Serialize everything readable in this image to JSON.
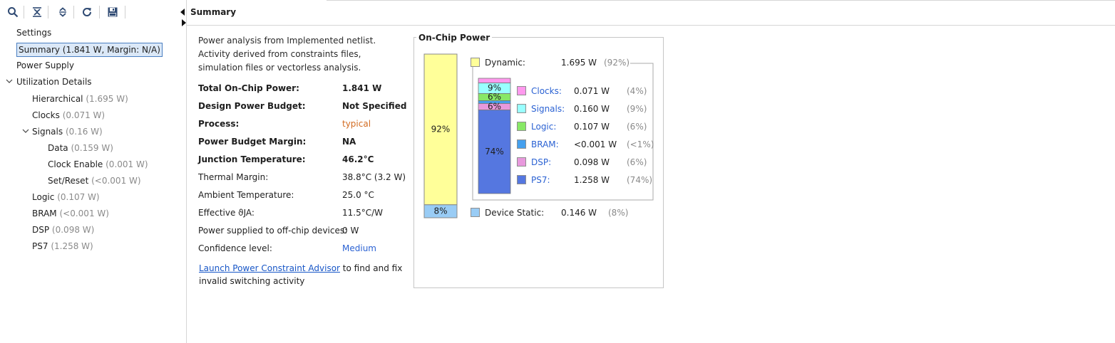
{
  "toolbar": {
    "icons": [
      "search-icon",
      "collapse-all-icon",
      "expand-all-icon",
      "refresh-icon",
      "save-icon"
    ]
  },
  "tree": {
    "settings": "Settings",
    "summary": "Summary (1.841 W, Margin: N/A)",
    "power_supply": "Power Supply",
    "utilization": "Utilization Details",
    "hierarchical": {
      "label": "Hierarchical",
      "value": "(1.695 W)"
    },
    "clocks": {
      "label": "Clocks",
      "value": "(0.071 W)"
    },
    "signals": {
      "label": "Signals",
      "value": "(0.16 W)"
    },
    "data": {
      "label": "Data",
      "value": "(0.159 W)"
    },
    "clock_enable": {
      "label": "Clock Enable",
      "value": "(0.001 W)"
    },
    "set_reset": {
      "label": "Set/Reset",
      "value": "(<0.001 W)"
    },
    "logic": {
      "label": "Logic",
      "value": "(0.107 W)"
    },
    "bram": {
      "label": "BRAM",
      "value": "(<0.001 W)"
    },
    "dsp": {
      "label": "DSP",
      "value": "(0.098 W)"
    },
    "ps7": {
      "label": "PS7",
      "value": "(1.258 W)"
    }
  },
  "tab": {
    "title": "Summary"
  },
  "summary": {
    "intro": "Power analysis from Implemented netlist. Activity derived from constraints files, simulation files or vectorless analysis.",
    "rows": [
      {
        "label": "Total On-Chip Power:",
        "value": "1.841 W"
      },
      {
        "label": "Design Power Budget:",
        "value": "Not Specified"
      },
      {
        "label": "Process:",
        "value": "typical"
      },
      {
        "label": "Power Budget Margin:",
        "value": "NA"
      },
      {
        "label": "Junction Temperature:",
        "value": "46.2°C"
      },
      {
        "label": "Thermal Margin:",
        "value": "38.8°C (3.2 W)"
      },
      {
        "label": "Ambient Temperature:",
        "value": "25.0 °C"
      },
      {
        "label": "Effective ϑJA:",
        "value": "11.5°C/W"
      },
      {
        "label": "Power supplied to off-chip devices:",
        "value": "0 W"
      },
      {
        "label": "Confidence level:",
        "value": "Medium"
      }
    ],
    "advisor_link": "Launch Power Constraint Advisor",
    "advisor_text": " to find and fix invalid switching activity"
  },
  "colors": {
    "dynamic": "#ffff99",
    "static": "#99ccf5",
    "clocks": "#ff99ee",
    "signals": "#99ffff",
    "logic": "#88e866",
    "bram": "#45a0ee",
    "dsp": "#e899dd",
    "ps7": "#5577e0"
  },
  "chart_data": {
    "type": "bar",
    "title": "On-Chip Power",
    "total": {
      "categories": [
        "Dynamic",
        "Device Static"
      ],
      "values": [
        1.695,
        0.146
      ],
      "percent_labels": [
        "92%",
        "8%"
      ]
    },
    "dynamic_breakdown": {
      "categories": [
        "Clocks",
        "Signals",
        "Logic",
        "BRAM",
        "DSP",
        "PS7"
      ],
      "values": [
        0.071,
        0.16,
        0.107,
        0.0005,
        0.098,
        1.258
      ],
      "percent_labels": [
        "",
        "9%",
        "6%",
        "",
        "6%",
        "74%"
      ]
    },
    "legend": {
      "dynamic": {
        "label": "Dynamic:",
        "value": "1.695 W",
        "pct": "(92%)"
      },
      "static": {
        "label": "Device Static:",
        "value": "0.146 W",
        "pct": "(8%)"
      },
      "items": [
        {
          "label": "Clocks",
          "value": "0.071 W",
          "pct": "(4%)"
        },
        {
          "label": "Signals",
          "value": "0.160 W",
          "pct": "(9%)"
        },
        {
          "label": "Logic",
          "value": "0.107 W",
          "pct": "(6%)"
        },
        {
          "label": "BRAM",
          "value": "<0.001 W",
          "pct": "(<1%)"
        },
        {
          "label": "DSP",
          "value": "0.098 W",
          "pct": "(6%)"
        },
        {
          "label": "PS7",
          "value": "1.258 W",
          "pct": "(74%)"
        }
      ]
    }
  }
}
